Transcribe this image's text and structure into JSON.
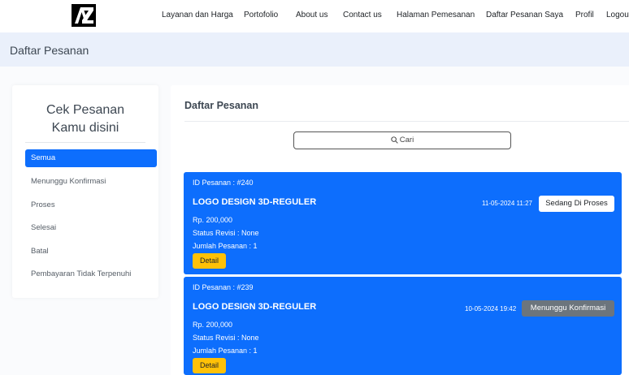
{
  "nav": {
    "items": [
      "Layanan dan Harga",
      "Portofolio",
      "About us",
      "Contact us",
      "Halaman Pemesanan",
      "Daftar Pesanan Saya",
      "Profil",
      "Logout"
    ]
  },
  "band": {
    "title": "Daftar Pesanan"
  },
  "sidebar": {
    "title_line1": "Cek Pesanan",
    "title_line2": "Kamu disini",
    "items": [
      {
        "label": "Semua"
      },
      {
        "label": "Menunggu Konfirmasi"
      },
      {
        "label": "Proses"
      },
      {
        "label": "Selesai"
      },
      {
        "label": "Batal"
      },
      {
        "label": "Pembayaran Tidak Terpenuhi"
      }
    ]
  },
  "main": {
    "title": "Daftar Pesanan",
    "search_label": "Cari",
    "orders": [
      {
        "id": "ID Pesanan : #240",
        "name": "LOGO DESIGN 3D-REGULER",
        "price": "Rp. 200,000",
        "revision": "Status Revisi : None",
        "quantity": "Jumlah Pesanan : 1",
        "detail": "Detail",
        "date": "11-05-2024 11:27",
        "status": "Sedang Di Proses"
      },
      {
        "id": "ID Pesanan : #239",
        "name": "LOGO DESIGN 3D-REGULER",
        "price": "Rp. 200,000",
        "revision": "Status Revisi : None",
        "quantity": "Jumlah Pesanan : 1",
        "detail": "Detail",
        "date": "10-05-2024 19:42",
        "status": "Menunggu Konfirmasi"
      }
    ]
  },
  "colors": {
    "primary": "#0d6efd",
    "warning": "#ffc107",
    "secondary": "#6c757d",
    "band": "#eaf0fb"
  }
}
